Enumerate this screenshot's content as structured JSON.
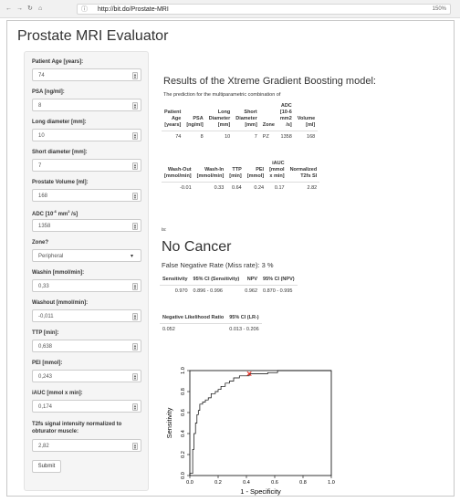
{
  "browser": {
    "url": "http://bit.do/Prostate-MRI",
    "zoom": "150%"
  },
  "app": {
    "title": "Prostate MRI Evaluator"
  },
  "sidebar": {
    "patient_age": {
      "label": "Patient Age [years]:",
      "value": "74"
    },
    "psa": {
      "label": "PSA [ng/ml]:",
      "value": "8"
    },
    "long_diameter": {
      "label": "Long diameter [mm]:",
      "value": "10"
    },
    "short_diameter": {
      "label": "Short diameter [mm]:",
      "value": "7"
    },
    "prostate_volume": {
      "label": "Prostate Volume [ml]:",
      "value": "168"
    },
    "adc": {
      "label_pre": "ADC [10",
      "label_sup1": "-6",
      "label_mid": " mm",
      "label_sup2": "2",
      "label_post": " /s]",
      "value": "1358"
    },
    "zone": {
      "label": "Zone?",
      "value": "Peripheral"
    },
    "washin": {
      "label": "Washin [mmol/min]:",
      "value": "0,33"
    },
    "washout": {
      "label": "Washout [mmol/min]:",
      "value": "-0,011"
    },
    "ttp": {
      "label": "TTP [min]:",
      "value": "0,638"
    },
    "pei": {
      "label": "PEI [mmol]:",
      "value": "0,243"
    },
    "iauc": {
      "label": "iAUC [mmol x min]:",
      "value": "0,174"
    },
    "t2fs": {
      "label": "T2fs signal intensity normalized to obturator muscle:",
      "value": "2,82"
    },
    "submit_label": "Submit"
  },
  "main": {
    "results_title": "Results of the Xtreme Gradient Boosting model:",
    "prediction_text": "The prediction for the multiparametric combination of",
    "table1": {
      "headers": [
        "Patient Age [years]",
        "PSA [ng/ml]",
        "Long Diameter [mm]",
        "Short Diameter [mm]",
        "Zone",
        "ADC [10-6 mm2 /s]",
        "Volume [ml]"
      ],
      "row": [
        "74",
        "8",
        "10",
        "7",
        "PZ",
        "1358",
        "168"
      ]
    },
    "table2": {
      "headers": [
        "Wash-Out [mmol/min]",
        "Wash-In [mmol/min]",
        "TTP [min]",
        "PEI [mmol]",
        "iAUC [mmol x min]",
        "Normalized T2fs SI"
      ],
      "row": [
        "-0.01",
        "0.33",
        "0.64",
        "0.24",
        "0.17",
        "2.82"
      ]
    },
    "is_text": "is:",
    "verdict": "No Cancer",
    "fnr": "False Negative Rate (Miss rate): 3 %",
    "table3": {
      "headers": [
        "Sensitivity",
        "95% CI (Sensitivity)",
        "NPV",
        "95% CI (NPV)"
      ],
      "row": [
        "0.970",
        "0.896 - 0.996",
        "0.962",
        "0.870 - 0.995"
      ]
    },
    "table4": {
      "headers": [
        "Negative Likelihood Ratio",
        "95% CI (LR-)"
      ],
      "row": [
        "0.052",
        "0.013 - 0.206"
      ]
    }
  },
  "chart_data": {
    "type": "line",
    "xlabel": "1 - Specificity",
    "ylabel": "Sensitivity",
    "xlim": [
      0,
      1
    ],
    "ylim": [
      0,
      1
    ],
    "xticks": [
      "0.0",
      "0.2",
      "0.4",
      "0.6",
      "0.8",
      "1.0"
    ],
    "yticks": [
      "0.0",
      "0.2",
      "0.4",
      "0.6",
      "0.8",
      "1.0"
    ],
    "series": [
      {
        "points": [
          [
            0,
            0
          ],
          [
            0,
            0.02
          ],
          [
            0.02,
            0.02
          ],
          [
            0.02,
            0.25
          ],
          [
            0.03,
            0.25
          ],
          [
            0.03,
            0.4
          ],
          [
            0.04,
            0.4
          ],
          [
            0.04,
            0.5
          ],
          [
            0.05,
            0.5
          ],
          [
            0.05,
            0.58
          ],
          [
            0.06,
            0.58
          ],
          [
            0.06,
            0.62
          ],
          [
            0.07,
            0.62
          ],
          [
            0.07,
            0.68
          ],
          [
            0.09,
            0.68
          ],
          [
            0.09,
            0.7
          ],
          [
            0.11,
            0.7
          ],
          [
            0.11,
            0.72
          ],
          [
            0.13,
            0.72
          ],
          [
            0.13,
            0.74
          ],
          [
            0.15,
            0.74
          ],
          [
            0.15,
            0.78
          ],
          [
            0.18,
            0.78
          ],
          [
            0.18,
            0.8
          ],
          [
            0.2,
            0.8
          ],
          [
            0.2,
            0.82
          ],
          [
            0.22,
            0.82
          ],
          [
            0.22,
            0.85
          ],
          [
            0.25,
            0.85
          ],
          [
            0.25,
            0.88
          ],
          [
            0.28,
            0.88
          ],
          [
            0.28,
            0.9
          ],
          [
            0.31,
            0.9
          ],
          [
            0.31,
            0.93
          ],
          [
            0.35,
            0.93
          ],
          [
            0.35,
            0.95
          ],
          [
            0.42,
            0.95
          ],
          [
            0.42,
            0.97
          ],
          [
            0.55,
            0.97
          ],
          [
            0.55,
            0.98
          ],
          [
            0.62,
            0.98
          ],
          [
            0.62,
            1.0
          ],
          [
            1.0,
            1.0
          ]
        ]
      }
    ],
    "marker": {
      "x": 0.42,
      "y": 0.97,
      "color": "#e8261b"
    },
    "line_color": "#000000",
    "grid": false
  }
}
